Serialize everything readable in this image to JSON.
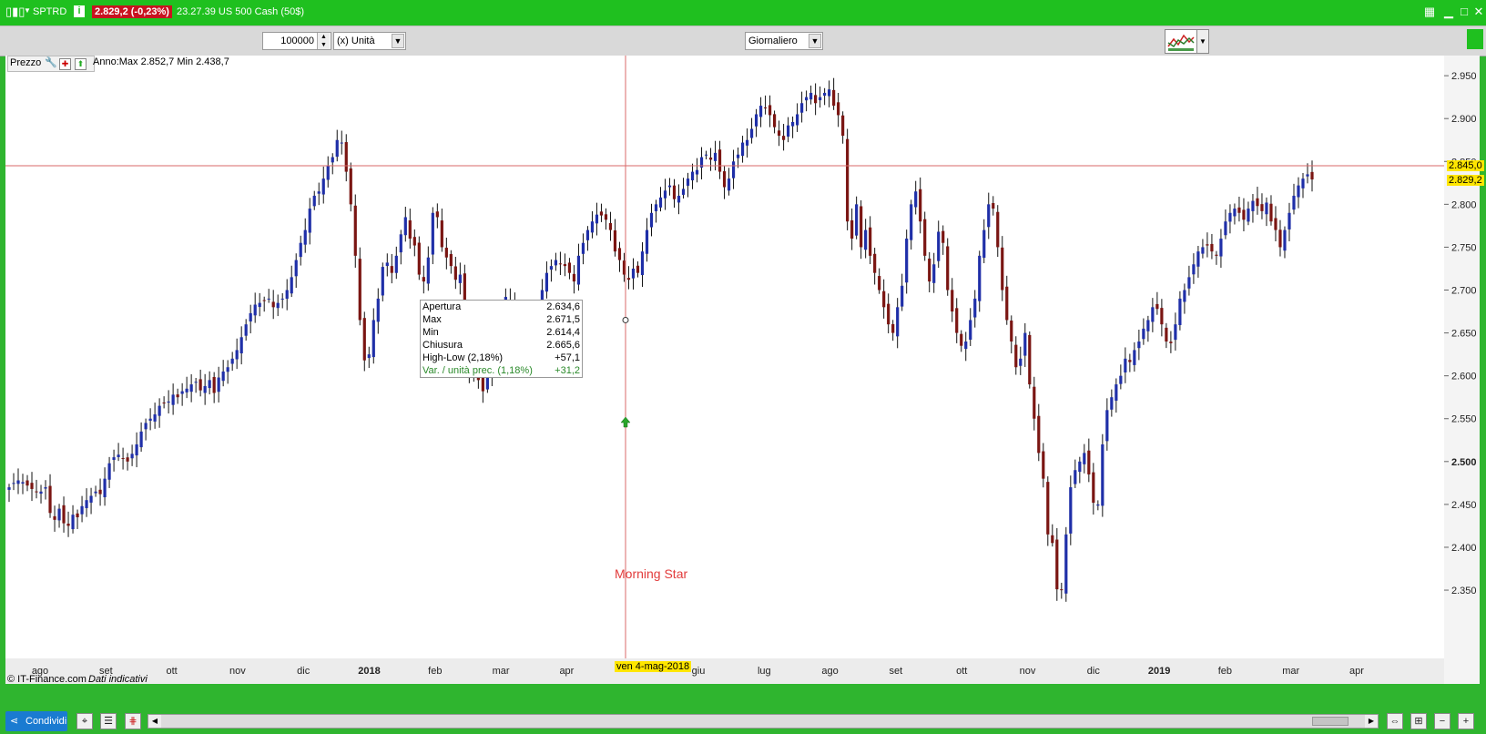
{
  "titlebar": {
    "symbol": "SPTRD",
    "price_change": "2.829,2 (-0,23%)",
    "time_and_name": "23.27.39 US 500 Cash (50$)",
    "info_glyph": "i"
  },
  "toolbar": {
    "quantity_value": "100000",
    "unit_select": "(x) Unità",
    "period_select": "Giornaliero"
  },
  "panel": {
    "label": "Prezzo",
    "range_text": "Anno:Max 2.852,7 Min 2.438,7"
  },
  "tooltip": {
    "rows": [
      {
        "label": "Apertura",
        "value": "2.634,6"
      },
      {
        "label": "Max",
        "value": "2.671,5"
      },
      {
        "label": "Min",
        "value": "2.614,4"
      },
      {
        "label": "Chiusura",
        "value": "2.665,6"
      },
      {
        "label": "High-Low  (2,18%)",
        "value": "+57,1"
      },
      {
        "label": "Var. / unità prec. (1,18%)",
        "value": "+31,2"
      }
    ]
  },
  "annotation": "Morning Star",
  "watermark": {
    "copyright": "© IT-Finance.com",
    "note": "Dati indicativi"
  },
  "cursor_date_label": "ven 4-mag-2018",
  "price_tags": {
    "crosshair": "2.845,0",
    "last": "2.829,2"
  },
  "colors": {
    "accent_green": "#2fb52f",
    "badge_red": "#c8131f",
    "up_candle": "#1f2fa8",
    "down_candle": "#7a1512",
    "crosshair": "#d96a6a",
    "tag_yellow": "#ffe600"
  },
  "bottombar": {
    "share_label": "Condividi"
  },
  "chart_data": {
    "type": "candlestick",
    "instrument": "US 500 Cash (50$)",
    "timeframe": "Giornaliero",
    "x_axis": {
      "tick_labels": [
        "ago",
        "set",
        "ott",
        "nov",
        "dic",
        "2018",
        "feb",
        "mar",
        "apr",
        "mag",
        "giu",
        "lug",
        "ago",
        "set",
        "ott",
        "nov",
        "dic",
        "2019",
        "feb",
        "mar",
        "apr"
      ],
      "bold_labels": [
        "2018",
        "2019"
      ]
    },
    "y_axis": {
      "tick_labels": [
        "2.950",
        "2.900",
        "2.850",
        "2.800",
        "2.750",
        "2.700",
        "2.650",
        "2.600",
        "2.550",
        "2.500",
        "2.450",
        "2.400",
        "2.350"
      ],
      "bold_labels": [
        "2.500"
      ],
      "ylim": [
        2315,
        2965
      ],
      "side": "right"
    },
    "series": [
      {
        "name": "close",
        "values": [
          2470,
          2475,
          2478,
          2476,
          2472,
          2468,
          2465,
          2465,
          2470,
          2440,
          2432,
          2445,
          2428,
          2425,
          2438,
          2435,
          2448,
          2455,
          2460,
          2465,
          2462,
          2480,
          2498,
          2505,
          2508,
          2504,
          2500,
          2509,
          2520,
          2535,
          2545,
          2550,
          2555,
          2565,
          2568,
          2570,
          2578,
          2575,
          2582,
          2585,
          2590,
          2593,
          2583,
          2588,
          2595,
          2580,
          2598,
          2605,
          2610,
          2620,
          2630,
          2645,
          2660,
          2673,
          2683,
          2685,
          2688,
          2690,
          2680,
          2685,
          2690,
          2700,
          2715,
          2735,
          2755,
          2770,
          2795,
          2810,
          2815,
          2830,
          2845,
          2855,
          2875,
          2872,
          2838,
          2800,
          2740,
          2665,
          2618,
          2625,
          2665,
          2690,
          2727,
          2732,
          2720,
          2740,
          2765,
          2785,
          2760,
          2752,
          2718,
          2710,
          2738,
          2790,
          2785,
          2750,
          2738,
          2728,
          2712,
          2718,
          2655,
          2605,
          2620,
          2595,
          2582,
          2605,
          2640,
          2655,
          2670,
          2692,
          2685,
          2665,
          2648,
          2645,
          2638,
          2665,
          2680,
          2700,
          2720,
          2728,
          2735,
          2730,
          2728,
          2720,
          2710,
          2740,
          2755,
          2770,
          2780,
          2788,
          2787,
          2782,
          2770,
          2745,
          2735,
          2718,
          2712,
          2725,
          2720,
          2745,
          2770,
          2790,
          2800,
          2808,
          2816,
          2822,
          2806,
          2810,
          2818,
          2830,
          2838,
          2840,
          2855,
          2858,
          2852,
          2860,
          2838,
          2820,
          2830,
          2850,
          2858,
          2872,
          2875,
          2888,
          2905,
          2915,
          2912,
          2904,
          2890,
          2880,
          2875,
          2892,
          2896,
          2905,
          2918,
          2925,
          2930,
          2918,
          2925,
          2930,
          2934,
          2915,
          2904,
          2880,
          2780,
          2760,
          2800,
          2750,
          2770,
          2740,
          2720,
          2700,
          2680,
          2660,
          2650,
          2680,
          2705,
          2760,
          2800,
          2815,
          2780,
          2740,
          2710,
          2730,
          2768,
          2755,
          2700,
          2675,
          2650,
          2635,
          2640,
          2665,
          2690,
          2740,
          2770,
          2800,
          2795,
          2750,
          2700,
          2665,
          2640,
          2610,
          2620,
          2650,
          2590,
          2550,
          2510,
          2480,
          2415,
          2405,
          2351,
          2350,
          2415,
          2470,
          2490,
          2500,
          2510,
          2485,
          2452,
          2450,
          2520,
          2560,
          2575,
          2590,
          2600,
          2620,
          2616,
          2630,
          2640,
          2655,
          2665,
          2680,
          2678,
          2660,
          2640,
          2638,
          2660,
          2690,
          2700,
          2715,
          2730,
          2745,
          2750,
          2752,
          2745,
          2740,
          2760,
          2780,
          2790,
          2795,
          2790,
          2782,
          2795,
          2804,
          2798,
          2792,
          2802,
          2780,
          2770,
          2750,
          2770,
          2790,
          2810,
          2822,
          2830,
          2835,
          2829
        ]
      }
    ],
    "crosshair": {
      "date": "ven 4-mag-2018",
      "price": 2845.0
    },
    "last_price": 2829.2,
    "grid": false
  }
}
